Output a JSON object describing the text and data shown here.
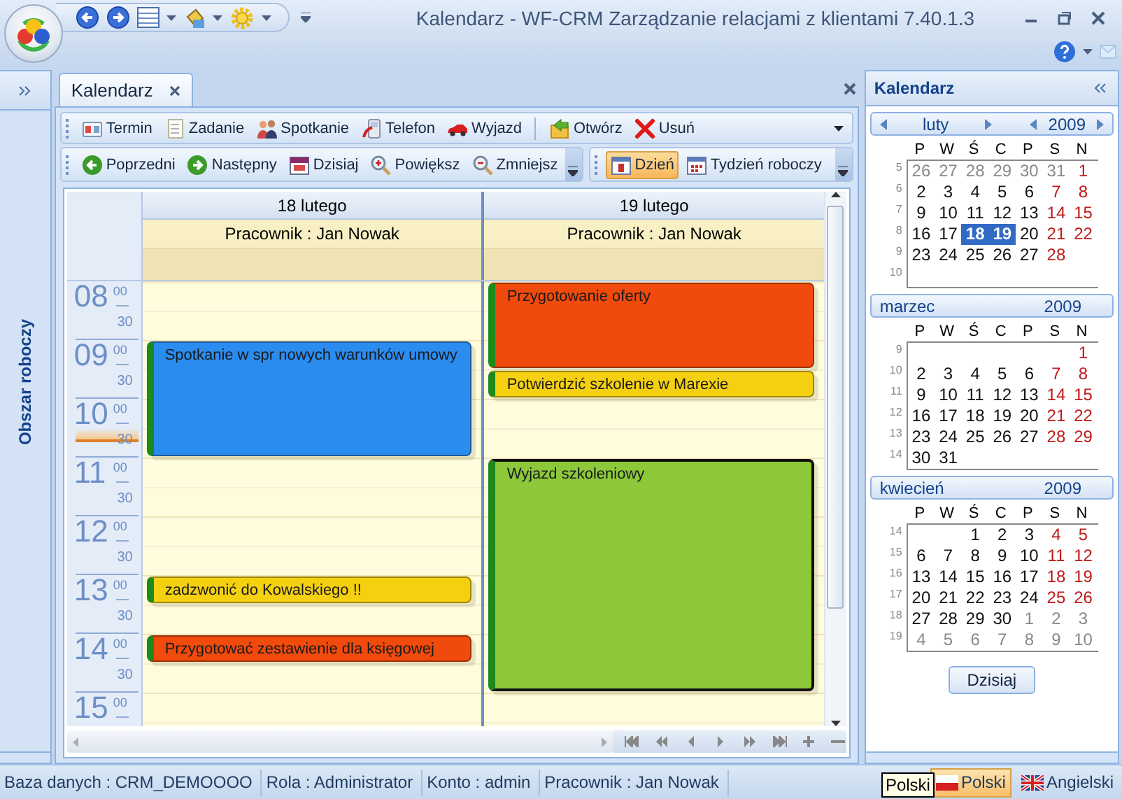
{
  "window": {
    "title": "Kalendarz - WF-CRM Zarządzanie relacjami z klientami 7.40.1.3"
  },
  "workspace_panel": {
    "label": "Obszar roboczy"
  },
  "tabs": [
    {
      "label": "Kalendarz",
      "selected": true
    }
  ],
  "command_bar": {
    "groups": [
      [
        {
          "label": "Termin",
          "kind": "termin"
        },
        {
          "label": "Zadanie",
          "kind": "task"
        },
        {
          "label": "Spotkanie",
          "kind": "meeting"
        },
        {
          "label": "Telefon",
          "kind": "phone"
        },
        {
          "label": "Wyjazd",
          "kind": "trip"
        }
      ],
      [
        {
          "label": "Otwórz",
          "kind": "open"
        },
        {
          "label": "Usuń",
          "kind": "delete"
        }
      ]
    ]
  },
  "navigation_bar": {
    "items": [
      {
        "label": "Poprzedni",
        "kind": "prev"
      },
      {
        "label": "Następny",
        "kind": "next"
      },
      {
        "label": "Dzisiaj",
        "kind": "today"
      },
      {
        "label": "Powiększ",
        "kind": "zoomin"
      },
      {
        "label": "Zmniejsz",
        "kind": "zoomout"
      }
    ]
  },
  "view_bar": {
    "items": [
      {
        "label": "Dzień",
        "kind": "day",
        "selected": true
      },
      {
        "label": "Tydzień roboczy",
        "kind": "week",
        "selected": false
      }
    ]
  },
  "day_view": {
    "hours": [
      {
        "hour": "08",
        "minutes": "00",
        "half": "30"
      },
      {
        "hour": "09",
        "minutes": "00",
        "half": "30"
      },
      {
        "hour": "10",
        "minutes": "00",
        "half": "30"
      },
      {
        "hour": "11",
        "minutes": "00",
        "half": "30"
      },
      {
        "hour": "12",
        "minutes": "00",
        "half": "30"
      },
      {
        "hour": "13",
        "minutes": "00",
        "half": "30"
      },
      {
        "hour": "14",
        "minutes": "00",
        "half": "30"
      },
      {
        "hour": "15",
        "minutes": "00"
      }
    ],
    "columns": [
      {
        "date": "18 lutego",
        "employee": "Pracownik : Jan Nowak",
        "events": [
          {
            "title": "Spotkanie w spr nowych warunków umowy",
            "color": "#2b8cf0",
            "selected": false
          },
          {
            "title": "zadzwonić do Kowalskiego !!",
            "color": "#f5d010",
            "selected": false
          },
          {
            "title": "Przygotować zestawienie dla księgowej",
            "color": "#f04a0c",
            "selected": false
          }
        ]
      },
      {
        "date": "19 lutego",
        "employee": "Pracownik : Jan Nowak",
        "events": [
          {
            "title": "Przygotowanie oferty",
            "color": "#f04a0c",
            "selected": false
          },
          {
            "title": "Potwierdzić szkolenie w Marexie",
            "color": "#f5d010",
            "selected": false
          },
          {
            "title": "Wyjazd szkoleniowy",
            "color": "#8cc83a",
            "selected": true
          }
        ]
      }
    ]
  },
  "side_panel": {
    "title": "Kalendarz",
    "today_button": "Dzisiaj",
    "months": [
      {
        "month": "luty",
        "year": "2009",
        "nav": true,
        "weekdays": [
          "P",
          "W",
          "Ś",
          "C",
          "P",
          "S",
          "N"
        ],
        "weeks": [
          {
            "week": "5",
            "days": [
              {
                "d": "26",
                "outside": true,
                "selected": false
              },
              {
                "d": "27",
                "outside": true,
                "selected": false
              },
              {
                "d": "28",
                "outside": true,
                "selected": false
              },
              {
                "d": "29",
                "outside": true,
                "selected": false
              },
              {
                "d": "30",
                "outside": true,
                "selected": false
              },
              {
                "d": "31",
                "outside": true,
                "selected": false
              },
              {
                "d": "1",
                "outside": false,
                "selected": false
              }
            ]
          },
          {
            "week": "6",
            "days": [
              {
                "d": "2",
                "outside": false,
                "selected": false
              },
              {
                "d": "3",
                "outside": false,
                "selected": false
              },
              {
                "d": "4",
                "outside": false,
                "selected": false
              },
              {
                "d": "5",
                "outside": false,
                "selected": false
              },
              {
                "d": "6",
                "outside": false,
                "selected": false
              },
              {
                "d": "7",
                "outside": false,
                "selected": false
              },
              {
                "d": "8",
                "outside": false,
                "selected": false
              }
            ]
          },
          {
            "week": "7",
            "days": [
              {
                "d": "9",
                "outside": false,
                "selected": false
              },
              {
                "d": "10",
                "outside": false,
                "selected": false
              },
              {
                "d": "11",
                "outside": false,
                "selected": false
              },
              {
                "d": "12",
                "outside": false,
                "selected": false
              },
              {
                "d": "13",
                "outside": false,
                "selected": false
              },
              {
                "d": "14",
                "outside": false,
                "selected": false
              },
              {
                "d": "15",
                "outside": false,
                "selected": false
              }
            ]
          },
          {
            "week": "8",
            "days": [
              {
                "d": "16",
                "outside": false,
                "selected": false
              },
              {
                "d": "17",
                "outside": false,
                "selected": false
              },
              {
                "d": "18",
                "outside": false,
                "selected": true
              },
              {
                "d": "19",
                "outside": false,
                "selected": true
              },
              {
                "d": "20",
                "outside": false,
                "selected": false
              },
              {
                "d": "21",
                "outside": false,
                "selected": false
              },
              {
                "d": "22",
                "outside": false,
                "selected": false
              }
            ]
          },
          {
            "week": "9",
            "days": [
              {
                "d": "23",
                "outside": false,
                "selected": false
              },
              {
                "d": "24",
                "outside": false,
                "selected": false
              },
              {
                "d": "25",
                "outside": false,
                "selected": false
              },
              {
                "d": "26",
                "outside": false,
                "selected": false
              },
              {
                "d": "27",
                "outside": false,
                "selected": false
              },
              {
                "d": "28",
                "outside": false,
                "selected": false
              }
            ]
          },
          {
            "week": "10"
          }
        ]
      },
      {
        "month": "marzec",
        "year": "2009",
        "nav": false,
        "weekdays": [
          "P",
          "W",
          "Ś",
          "C",
          "P",
          "S",
          "N"
        ],
        "weeks": [
          {
            "week": "9",
            "days": [
              {
                "d": "1",
                "outside": false,
                "selected": false
              }
            ]
          },
          {
            "week": "10",
            "days": [
              {
                "d": "2",
                "outside": false,
                "selected": false
              },
              {
                "d": "3",
                "outside": false,
                "selected": false
              },
              {
                "d": "4",
                "outside": false,
                "selected": false
              },
              {
                "d": "5",
                "outside": false,
                "selected": false
              },
              {
                "d": "6",
                "outside": false,
                "selected": false
              },
              {
                "d": "7",
                "outside": false,
                "selected": false
              },
              {
                "d": "8",
                "outside": false,
                "selected": false
              }
            ]
          },
          {
            "week": "11",
            "days": [
              {
                "d": "9",
                "outside": false,
                "selected": false
              },
              {
                "d": "10",
                "outside": false,
                "selected": false
              },
              {
                "d": "11",
                "outside": false,
                "selected": false
              },
              {
                "d": "12",
                "outside": false,
                "selected": false
              },
              {
                "d": "13",
                "outside": false,
                "selected": false
              },
              {
                "d": "14",
                "outside": false,
                "selected": false
              },
              {
                "d": "15",
                "outside": false,
                "selected": false
              }
            ]
          },
          {
            "week": "12",
            "days": [
              {
                "d": "16",
                "outside": false,
                "selected": false
              },
              {
                "d": "17",
                "outside": false,
                "selected": false
              },
              {
                "d": "18",
                "outside": false,
                "selected": false
              },
              {
                "d": "19",
                "outside": false,
                "selected": false
              },
              {
                "d": "20",
                "outside": false,
                "selected": false
              },
              {
                "d": "21",
                "outside": false,
                "selected": false
              },
              {
                "d": "22",
                "outside": false,
                "selected": false
              }
            ]
          },
          {
            "week": "13",
            "days": [
              {
                "d": "23",
                "outside": false,
                "selected": false
              },
              {
                "d": "24",
                "outside": false,
                "selected": false
              },
              {
                "d": "25",
                "outside": false,
                "selected": false
              },
              {
                "d": "26",
                "outside": false,
                "selected": false
              },
              {
                "d": "27",
                "outside": false,
                "selected": false
              },
              {
                "d": "28",
                "outside": false,
                "selected": false
              },
              {
                "d": "29",
                "outside": false,
                "selected": false
              }
            ]
          },
          {
            "week": "14",
            "days": [
              {
                "d": "30",
                "outside": false,
                "selected": false
              },
              {
                "d": "31",
                "outside": false,
                "selected": false
              }
            ]
          }
        ]
      },
      {
        "month": "kwiecień",
        "year": "2009",
        "nav": false,
        "weekdays": [
          "P",
          "W",
          "Ś",
          "C",
          "P",
          "S",
          "N"
        ],
        "weeks": [
          {
            "week": "14",
            "days": [
              {
                "d": "1",
                "outside": false,
                "selected": false
              },
              {
                "d": "2",
                "outside": false,
                "selected": false
              },
              {
                "d": "3",
                "outside": false,
                "selected": false
              },
              {
                "d": "4",
                "outside": false,
                "selected": false
              },
              {
                "d": "5",
                "outside": false,
                "selected": false
              }
            ]
          },
          {
            "week": "15",
            "days": [
              {
                "d": "6",
                "outside": false,
                "selected": false
              },
              {
                "d": "7",
                "outside": false,
                "selected": false
              },
              {
                "d": "8",
                "outside": false,
                "selected": false
              },
              {
                "d": "9",
                "outside": false,
                "selected": false
              },
              {
                "d": "10",
                "outside": false,
                "selected": false
              },
              {
                "d": "11",
                "outside": false,
                "selected": false
              },
              {
                "d": "12",
                "outside": false,
                "selected": false
              }
            ]
          },
          {
            "week": "16",
            "days": [
              {
                "d": "13",
                "outside": false,
                "selected": false
              },
              {
                "d": "14",
                "outside": false,
                "selected": false
              },
              {
                "d": "15",
                "outside": false,
                "selected": false
              },
              {
                "d": "16",
                "outside": false,
                "selected": false
              },
              {
                "d": "17",
                "outside": false,
                "selected": false
              },
              {
                "d": "18",
                "outside": false,
                "selected": false
              },
              {
                "d": "19",
                "outside": false,
                "selected": false
              }
            ]
          },
          {
            "week": "17",
            "days": [
              {
                "d": "20",
                "outside": false,
                "selected": false
              },
              {
                "d": "21",
                "outside": false,
                "selected": false
              },
              {
                "d": "22",
                "outside": false,
                "selected": false
              },
              {
                "d": "23",
                "outside": false,
                "selected": false
              },
              {
                "d": "24",
                "outside": false,
                "selected": false
              },
              {
                "d": "25",
                "outside": false,
                "selected": false
              },
              {
                "d": "26",
                "outside": false,
                "selected": false
              }
            ]
          },
          {
            "week": "18",
            "days": [
              {
                "d": "27",
                "outside": false,
                "selected": false
              },
              {
                "d": "28",
                "outside": false,
                "selected": false
              },
              {
                "d": "29",
                "outside": false,
                "selected": false
              },
              {
                "d": "30",
                "outside": false,
                "selected": false
              },
              {
                "d": "1",
                "outside": true,
                "selected": false
              },
              {
                "d": "2",
                "outside": true,
                "selected": false
              },
              {
                "d": "3",
                "outside": true,
                "selected": false
              }
            ]
          },
          {
            "week": "19",
            "days": [
              {
                "d": "4",
                "outside": true,
                "selected": false
              },
              {
                "d": "5",
                "outside": true,
                "selected": false
              },
              {
                "d": "6",
                "outside": true,
                "selected": false
              },
              {
                "d": "7",
                "outside": true,
                "selected": false
              },
              {
                "d": "8",
                "outside": true,
                "selected": false
              },
              {
                "d": "9",
                "outside": true,
                "selected": false
              },
              {
                "d": "10",
                "outside": true,
                "selected": false
              }
            ]
          }
        ]
      }
    ]
  },
  "status_bar": {
    "fields": [
      "Baza danych : CRM_DEMOOOO",
      "Rola : Administrator",
      "Konto : admin",
      "Pracownik : Jan Nowak"
    ],
    "tooltip": "Polski",
    "languages": [
      {
        "label": "Polski",
        "kind": "pl",
        "selected": true
      },
      {
        "label": "Angielski",
        "kind": "uk",
        "selected": false
      }
    ]
  }
}
